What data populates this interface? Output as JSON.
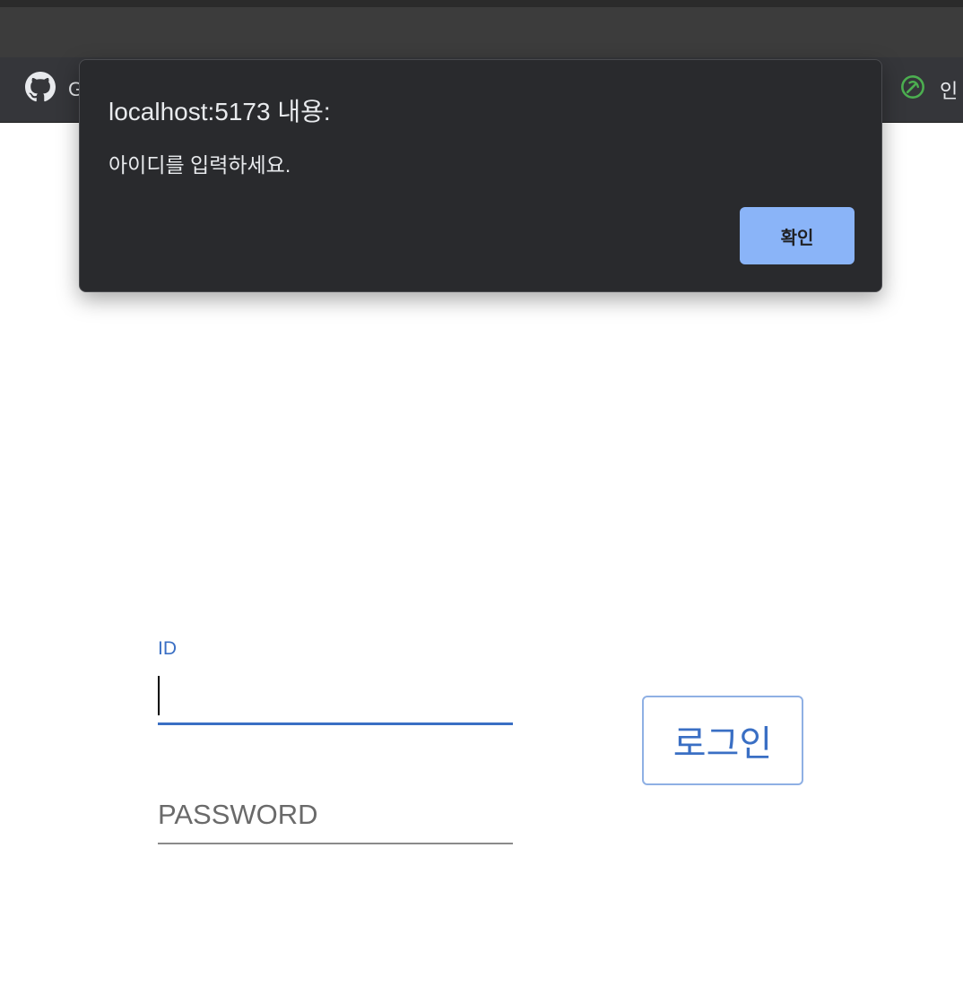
{
  "browser": {
    "bookmarks": [
      {
        "icon": "github-icon",
        "label": "G"
      },
      {
        "icon": "leaf-icon",
        "label": "인",
        "icon_color": "#4caf50"
      }
    ]
  },
  "alert": {
    "title": "localhost:5173 내용:",
    "message": "아이디를 입력하세요.",
    "ok_label": "확인",
    "ok_color": "#8ab4f8"
  },
  "login": {
    "id_label": "ID",
    "id_value": "",
    "password_placeholder": "PASSWORD",
    "login_button_label": "로그인",
    "accent_color": "#3a6fc4"
  }
}
